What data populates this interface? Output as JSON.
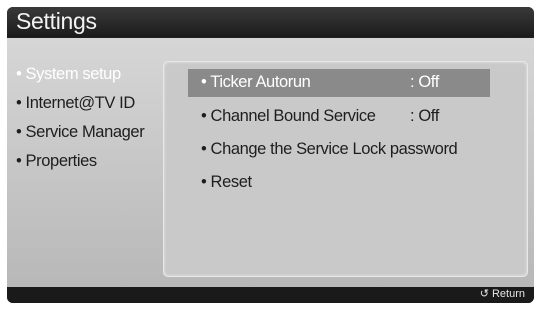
{
  "header": {
    "title": "Settings"
  },
  "left_menu": {
    "items": [
      {
        "label": "• System setup",
        "selected": true
      },
      {
        "label": "• Internet@TV ID",
        "selected": false
      },
      {
        "label": "• Service Manager",
        "selected": false
      },
      {
        "label": "• Properties",
        "selected": false
      }
    ]
  },
  "panel": {
    "options": [
      {
        "label": "• Ticker Autorun",
        "value": ": Off",
        "highlighted": true
      },
      {
        "label": "• Channel Bound Service",
        "value": ": Off",
        "highlighted": false
      },
      {
        "label": "• Change the Service Lock password",
        "value": "",
        "highlighted": false
      },
      {
        "label": "• Reset",
        "value": "",
        "highlighted": false
      }
    ]
  },
  "footer": {
    "return_label": "Return",
    "return_icon": "return-arrow-icon"
  },
  "colors": {
    "frame": "#202020",
    "content": "#c4c4c4",
    "highlight": "#8a8a8a",
    "selected_text": "#ffffff"
  }
}
